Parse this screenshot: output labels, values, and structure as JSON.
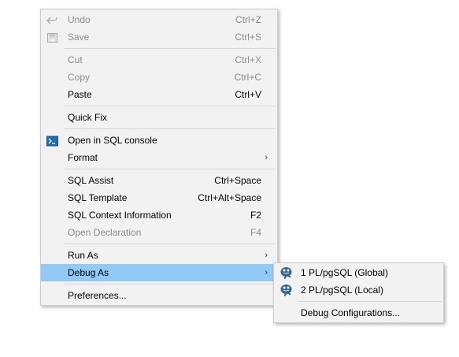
{
  "context_menu": {
    "items": [
      {
        "label": "Undo",
        "shortcut": "Ctrl+Z",
        "icon": "undo-icon",
        "enabled": false
      },
      {
        "label": "Save",
        "shortcut": "Ctrl+S",
        "icon": "save-icon",
        "enabled": false
      },
      {
        "label": "Cut",
        "shortcut": "Ctrl+X",
        "enabled": false
      },
      {
        "label": "Copy",
        "shortcut": "Ctrl+C",
        "enabled": false
      },
      {
        "label": "Paste",
        "shortcut": "Ctrl+V",
        "enabled": true
      },
      {
        "label": "Quick Fix",
        "shortcut": "",
        "enabled": true
      },
      {
        "label": "Open in SQL console",
        "shortcut": "",
        "icon": "console-icon",
        "enabled": true
      },
      {
        "label": "Format",
        "shortcut": "",
        "submenu": true,
        "enabled": true
      },
      {
        "label": "SQL Assist",
        "shortcut": "Ctrl+Space",
        "enabled": true
      },
      {
        "label": "SQL Template",
        "shortcut": "Ctrl+Alt+Space",
        "enabled": true
      },
      {
        "label": "SQL Context Information",
        "shortcut": "F2",
        "enabled": true
      },
      {
        "label": "Open Declaration",
        "shortcut": "F4",
        "enabled": false
      },
      {
        "label": "Run As",
        "shortcut": "",
        "submenu": true,
        "enabled": true
      },
      {
        "label": "Debug As",
        "shortcut": "",
        "submenu": true,
        "enabled": true,
        "selected": true
      },
      {
        "label": "Preferences...",
        "shortcut": "",
        "enabled": true
      }
    ]
  },
  "debug_submenu": {
    "items": [
      {
        "label": "1 PL/pgSQL (Global)",
        "icon": "postgresql-elephant-icon"
      },
      {
        "label": "2 PL/pgSQL (Local)",
        "icon": "postgresql-elephant-icon"
      },
      {
        "label": "Debug Configurations..."
      }
    ]
  },
  "colors": {
    "menu_bg": "#f2f2f2",
    "selection": "#91c9f7",
    "disabled_text": "#8a8a8a"
  }
}
